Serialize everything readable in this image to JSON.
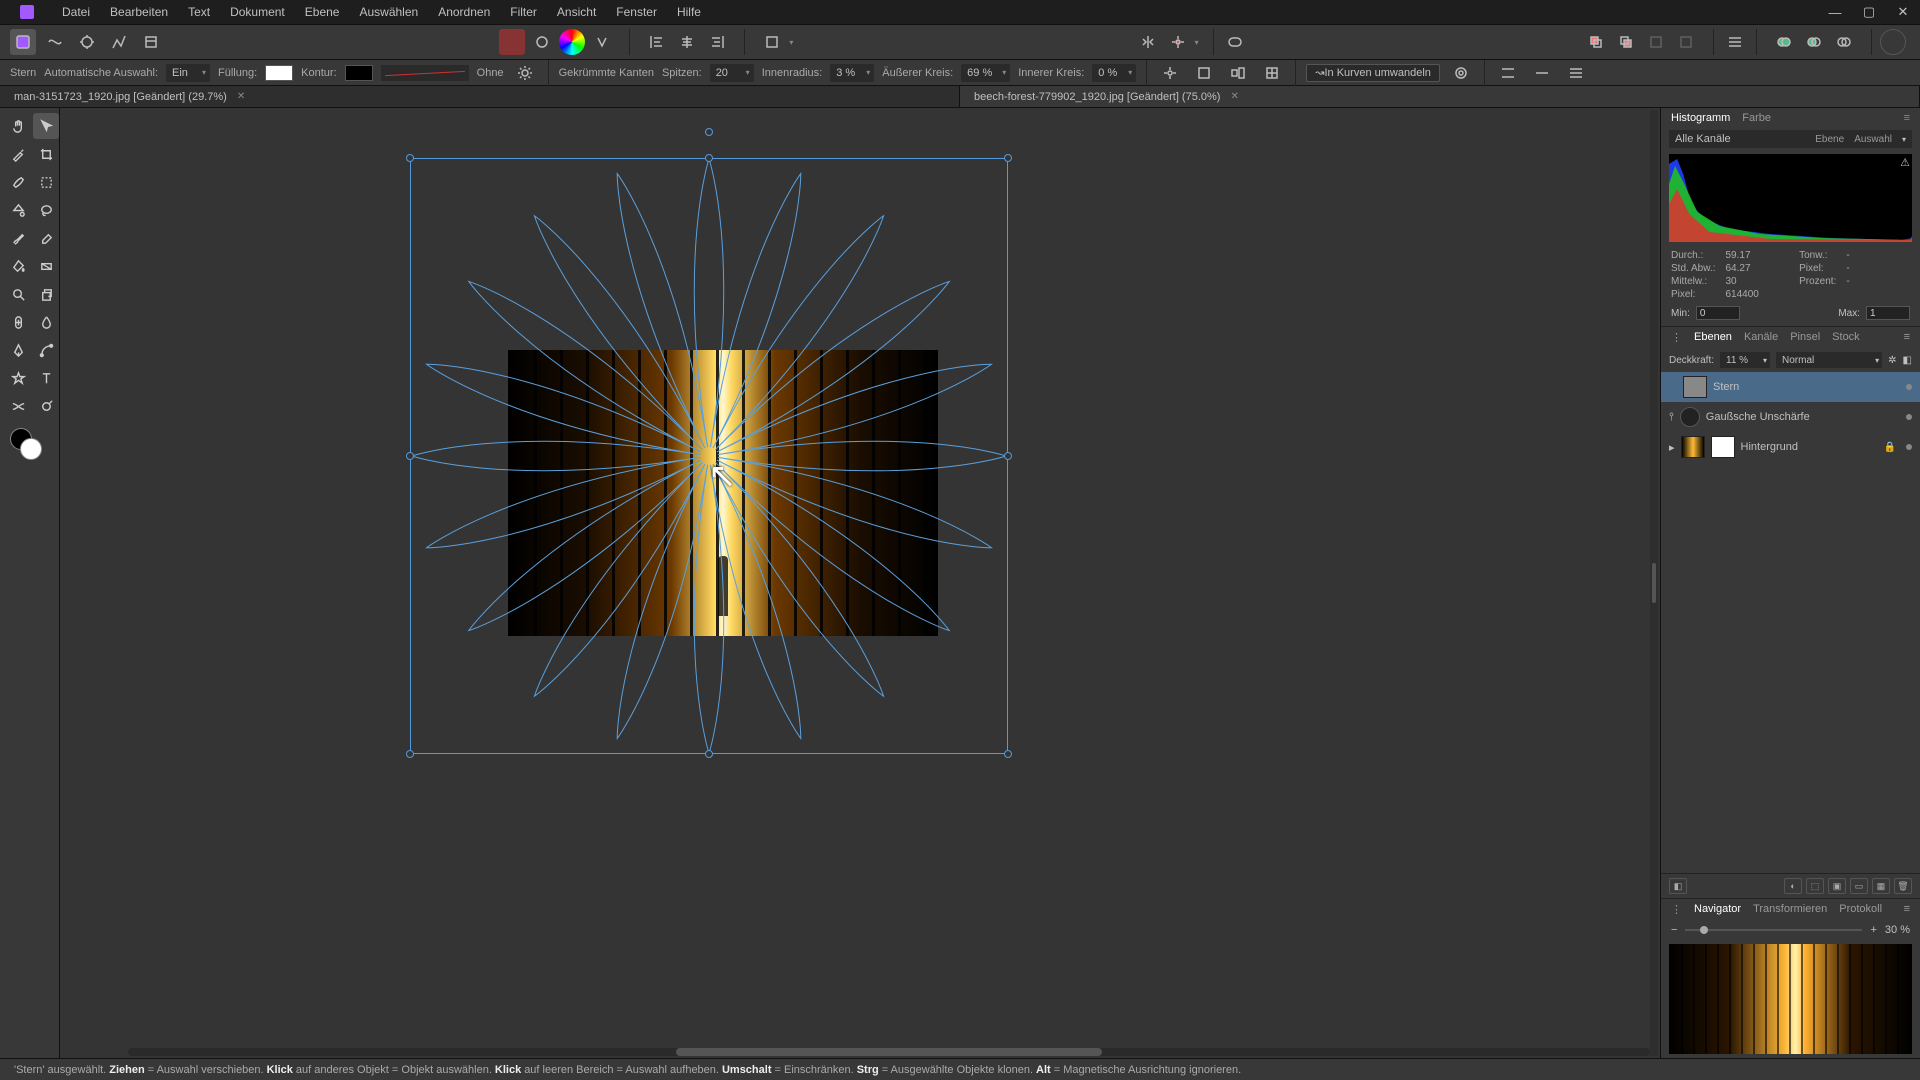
{
  "menu": {
    "items": [
      "Datei",
      "Bearbeiten",
      "Text",
      "Dokument",
      "Ebene",
      "Auswählen",
      "Anordnen",
      "Filter",
      "Ansicht",
      "Fenster",
      "Hilfe"
    ]
  },
  "tabs": [
    {
      "label": "man-3151723_1920.jpg [Geändert] (29.7%)"
    },
    {
      "label": "beech-forest-779902_1920.jpg [Geändert] (75.0%)"
    }
  ],
  "contextbar": {
    "shape": "Stern",
    "autoSelLbl": "Automatische Auswahl:",
    "autoSelVal": "Ein",
    "fillLbl": "Füllung:",
    "fillColor": "#ffffff",
    "strokeLbl": "Kontur:",
    "strokeColor": "#000000",
    "strokeStyleLbl": "Ohne",
    "smoothLbl": "Gekrümmte Kanten",
    "pointsLbl": "Spitzen:",
    "points": "20",
    "innerRadLbl": "Innenradius:",
    "innerRad": "3 %",
    "outerLbl": "Äußerer Kreis:",
    "outer": "69 %",
    "innerCircLbl": "Innerer Kreis:",
    "innerCirc": "0 %",
    "convertLbl": "In Kurven umwandeln"
  },
  "histogram": {
    "tabs": [
      "Histogramm",
      "Farbe"
    ],
    "channel": "Alle Kanäle",
    "opts": [
      "Ebene",
      "Auswahl"
    ],
    "warn": "⚠",
    "stats": {
      "mean_l": "Durch.:",
      "mean": "59.17",
      "sd_l": "Std. Abw.:",
      "sd": "64.27",
      "med_l": "Mittelw.:",
      "med": "30",
      "px_l": "Pixel:",
      "px": "614400",
      "tone_l": "Tonw.:",
      "tone": "-",
      "pxv_l": "Pixel:",
      "pxv": "-",
      "pct_l": "Prozent:",
      "pct": "-"
    },
    "min_l": "Min:",
    "min": "0",
    "max_l": "Max:",
    "max": "1"
  },
  "layersPanel": {
    "tabs": [
      "Ebenen",
      "Kanäle",
      "Pinsel",
      "Stock"
    ],
    "opacity_l": "Deckkraft:",
    "opacity": "11 %",
    "blend": "Normal",
    "layers": [
      {
        "name": "Stern"
      },
      {
        "name": "Gaußsche Unschärfe"
      },
      {
        "name": "Hintergrund"
      }
    ]
  },
  "navPanel": {
    "tabs": [
      "Navigator",
      "Transformieren",
      "Protokoll"
    ],
    "zoom": "30 %"
  },
  "status": {
    "sel": "'Stern' ausgewählt.",
    "drag": "Ziehen",
    "drag_t": " = Auswahl verschieben. ",
    "click": "Klick",
    "click_t": " auf anderes Objekt = Objekt auswählen. ",
    "click2": "Klick",
    "click2_t": " auf leeren Bereich = Auswahl aufheben. ",
    "shift": "Umschalt",
    "shift_t": " = Einschränken. ",
    "ctrl": "Strg",
    "ctrl_t": " = Ausgewählte Objekte klonen. ",
    "alt": "Alt",
    "alt_t": " = Magnetische Ausrichtung ignorieren."
  },
  "colors": {
    "accent": "#5aa0dd"
  }
}
